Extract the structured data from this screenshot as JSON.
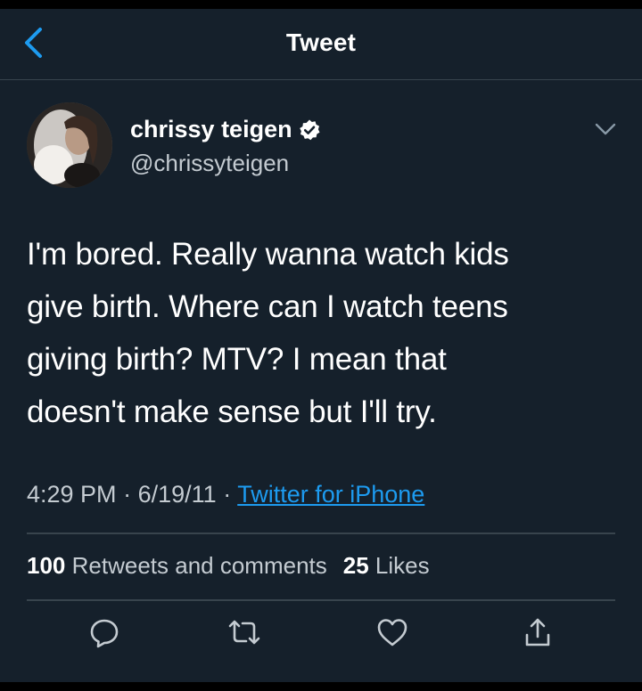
{
  "header": {
    "title": "Tweet",
    "back_icon": "chevron-left-icon"
  },
  "author": {
    "name": "chrissy teigen",
    "handle": "@chrissyteigen",
    "verified_icon": "verified-badge-icon",
    "avatar": "profile-photo"
  },
  "tweet": {
    "lines": [
      "I'm bored. Really wanna watch kids",
      "give birth. Where can I watch teens",
      "giving birth? MTV? I mean that",
      "doesn't make sense but I'll try."
    ],
    "time": "4:29 PM",
    "date": "6/19/11",
    "separator": "·",
    "source": "Twitter for iPhone"
  },
  "stats": {
    "retweets_count": "100",
    "retweets_label": "Retweets and comments",
    "likes_count": "25",
    "likes_label": "Likes"
  },
  "actions": {
    "reply_icon": "reply-icon",
    "retweet_icon": "retweet-icon",
    "like_icon": "heart-icon",
    "share_icon": "share-icon"
  },
  "colors": {
    "background": "#15202b",
    "accent": "#1d9bf0",
    "secondary_text": "#c4cbd1",
    "divider": "#38444d"
  }
}
